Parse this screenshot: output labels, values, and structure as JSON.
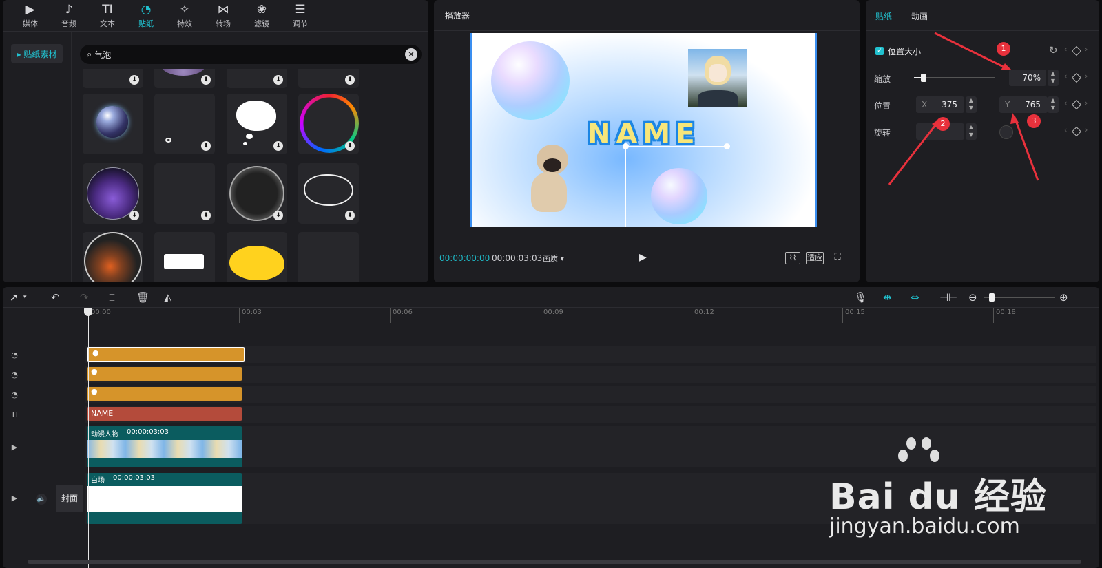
{
  "library": {
    "tabs": [
      {
        "label": "媒体",
        "icon": "media-icon",
        "glyph": "▶"
      },
      {
        "label": "音频",
        "icon": "audio-icon",
        "glyph": "♪"
      },
      {
        "label": "文本",
        "icon": "text-icon",
        "glyph": "TI"
      },
      {
        "label": "贴纸",
        "icon": "sticker-icon",
        "glyph": "◔"
      },
      {
        "label": "特效",
        "icon": "effects-icon",
        "glyph": "✧"
      },
      {
        "label": "转场",
        "icon": "transition-icon",
        "glyph": "⋈"
      },
      {
        "label": "滤镜",
        "icon": "filter-icon",
        "glyph": "❀"
      },
      {
        "label": "调节",
        "icon": "adjust-icon",
        "glyph": "☰"
      }
    ],
    "active_tab": "贴纸",
    "sidebar_item": "▸ 贴纸素材",
    "search_value": "气泡"
  },
  "player": {
    "title": "播放器",
    "preview_text": "NAME",
    "time_current": "00:00:00:00",
    "time_total": "00:00:03:03",
    "quality_label": "画质 ▾",
    "fit_label": "适应"
  },
  "props": {
    "tab_sticker": "贴纸",
    "tab_animation": "动画",
    "section_label": "位置大小",
    "scale_label": "缩放",
    "scale_value": "70%",
    "scale_fraction": 0.12,
    "position_label": "位置",
    "x_label": "X",
    "x_value": "375",
    "y_label": "Y",
    "y_value": "-765",
    "rotate_label": "旋转",
    "badges": [
      "1",
      "2",
      "3"
    ]
  },
  "timeline": {
    "ruler_ticks": [
      "00:00",
      "00:03",
      "00:06",
      "00:09",
      "00:12",
      "00:15",
      "00:18"
    ],
    "text_clip": "NAME",
    "video_clip_name": "动漫人物",
    "video_clip_duration": "00:00:03:03",
    "bg_clip_name": "白场",
    "bg_clip_duration": "00:00:03:03",
    "cover_label": "封面"
  },
  "colors": {
    "accent": "#21c1cf",
    "sticker_clip": "#d6942a",
    "text_clip": "#b44b3b",
    "video_clip": "#0b5c5f"
  },
  "watermark": {
    "logo": "Bai du 经验",
    "url": "jingyan.baidu.com"
  }
}
